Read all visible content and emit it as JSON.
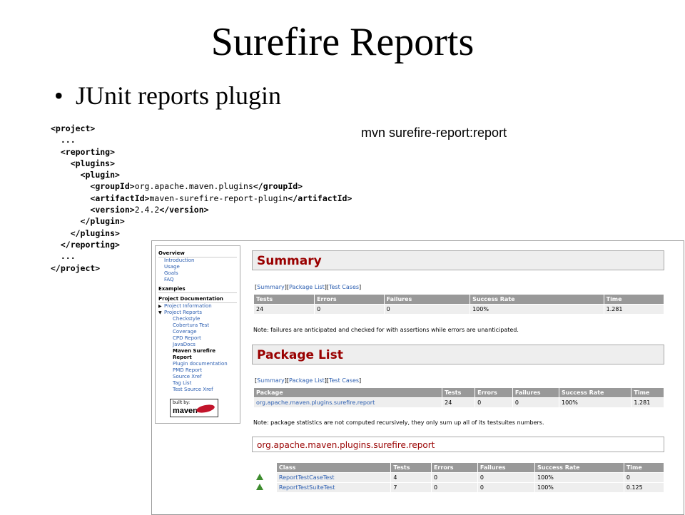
{
  "slide": {
    "title": "Surefire Reports",
    "bullet": "JUnit reports plugin",
    "command": "mvn surefire-report:report"
  },
  "code_lines": [
    {
      "indent": 0,
      "parts": [
        {
          "t": "<project>",
          "b": true
        }
      ]
    },
    {
      "indent": 2,
      "parts": [
        {
          "t": "...",
          "b": true
        }
      ]
    },
    {
      "indent": 2,
      "parts": [
        {
          "t": "<reporting>",
          "b": true
        }
      ]
    },
    {
      "indent": 4,
      "parts": [
        {
          "t": "<plugins>",
          "b": true
        }
      ]
    },
    {
      "indent": 6,
      "parts": [
        {
          "t": "<plugin>",
          "b": true
        }
      ]
    },
    {
      "indent": 8,
      "parts": [
        {
          "t": "<groupId>",
          "b": true
        },
        {
          "t": "org.apache.maven.plugins",
          "b": false
        },
        {
          "t": "</groupId>",
          "b": true
        }
      ]
    },
    {
      "indent": 8,
      "parts": [
        {
          "t": "<artifactId>",
          "b": true
        },
        {
          "t": "maven-surefire-report-plugin",
          "b": false
        },
        {
          "t": "</artifactId>",
          "b": true
        }
      ]
    },
    {
      "indent": 8,
      "parts": [
        {
          "t": "<version>",
          "b": true
        },
        {
          "t": "2.4.2",
          "b": false
        },
        {
          "t": "</version>",
          "b": true
        }
      ]
    },
    {
      "indent": 6,
      "parts": [
        {
          "t": "</plugin>",
          "b": true
        }
      ]
    },
    {
      "indent": 4,
      "parts": [
        {
          "t": "</plugins>",
          "b": true
        }
      ]
    },
    {
      "indent": 2,
      "parts": [
        {
          "t": "</reporting>",
          "b": true
        }
      ]
    },
    {
      "indent": 2,
      "parts": [
        {
          "t": "...",
          "b": true
        }
      ]
    },
    {
      "indent": 0,
      "parts": [
        {
          "t": "</project>",
          "b": true
        }
      ]
    }
  ],
  "sidebar": {
    "overview_head": "Overview",
    "overview_items": [
      "Introduction",
      "Usage",
      "Goals",
      "FAQ"
    ],
    "examples_head": "Examples",
    "project_head": "Project Documentation",
    "project_items": [
      "Project Information",
      "Project Reports"
    ],
    "report_items": [
      "Checkstyle",
      "Cobertura Test",
      "Coverage",
      "CPD Report",
      "JavaDocs"
    ],
    "current_item_1": "Maven Surefire",
    "current_item_2": "Report",
    "report_items_after": [
      "Plugin documentation",
      "PMD Report",
      "Source Xref",
      "Tag List",
      "Test Source Xref"
    ],
    "badge_built": "built by:",
    "badge_maven": "maven"
  },
  "report": {
    "summary_title": "Summary",
    "nav_links": [
      "Summary",
      "Package List",
      "Test Cases"
    ],
    "summary_headers": [
      "Tests",
      "Errors",
      "Failures",
      "Success Rate",
      "Time"
    ],
    "summary_row": [
      "24",
      "0",
      "0",
      "100%",
      "1.281"
    ],
    "summary_note": "Note: failures are anticipated and checked for with assertions while errors are unanticipated.",
    "package_title": "Package List",
    "package_headers": [
      "Package",
      "Tests",
      "Errors",
      "Failures",
      "Success Rate",
      "Time"
    ],
    "package_row": [
      "org.apache.maven.plugins.surefire.report",
      "24",
      "0",
      "0",
      "100%",
      "1.281"
    ],
    "package_note": "Note: package statistics are not computed recursively, they only sum up all of its testsuites numbers.",
    "pkg_section_title": "org.apache.maven.plugins.surefire.report",
    "class_headers": [
      "",
      "Class",
      "Tests",
      "Errors",
      "Failures",
      "Success Rate",
      "Time"
    ],
    "class_rows": [
      [
        "ReportTestCaseTest",
        "4",
        "0",
        "0",
        "100%",
        "0"
      ],
      [
        "ReportTestSuiteTest",
        "7",
        "0",
        "0",
        "100%",
        "0.125"
      ]
    ]
  },
  "colors": {
    "section_title": "#990000",
    "table_header": "#999999",
    "link": "#2a5db0"
  }
}
